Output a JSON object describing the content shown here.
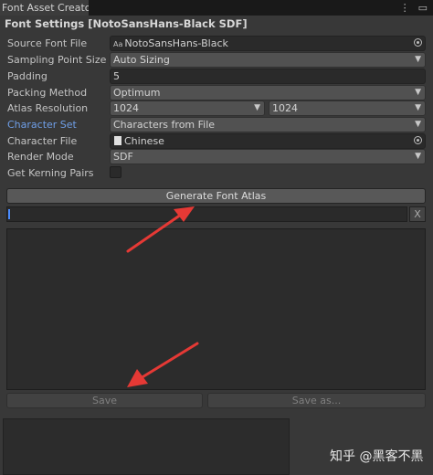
{
  "window": {
    "tab_title": "Font Asset Creator",
    "menu_icons": [
      "kebab-menu-icon",
      "maximize-icon"
    ]
  },
  "section_title": "Font Settings [NotoSansHans-Black SDF]",
  "fields": {
    "source_font_file": {
      "label": "Source Font File",
      "value": "NotoSansHans-Black",
      "icon": "Aa"
    },
    "sampling_point_size": {
      "label": "Sampling Point Size",
      "value": "Auto Sizing"
    },
    "padding": {
      "label": "Padding",
      "value": "5"
    },
    "packing_method": {
      "label": "Packing Method",
      "value": "Optimum"
    },
    "atlas_resolution": {
      "label": "Atlas Resolution",
      "width": "1024",
      "height": "1024"
    },
    "character_set": {
      "label": "Character Set",
      "value": "Characters from File"
    },
    "character_file": {
      "label": "Character File",
      "value": "Chinese"
    },
    "render_mode": {
      "label": "Render Mode",
      "value": "SDF"
    },
    "get_kerning_pairs": {
      "label": "Get Kerning Pairs",
      "checked": false
    }
  },
  "buttons": {
    "generate": "Generate Font Atlas",
    "clear": "X",
    "save": "Save",
    "save_as": "Save as..."
  },
  "watermark": "知乎 @黑客不黑",
  "colors": {
    "accent_label": "#6f9fe8",
    "annotation_arrow": "#e53935"
  }
}
